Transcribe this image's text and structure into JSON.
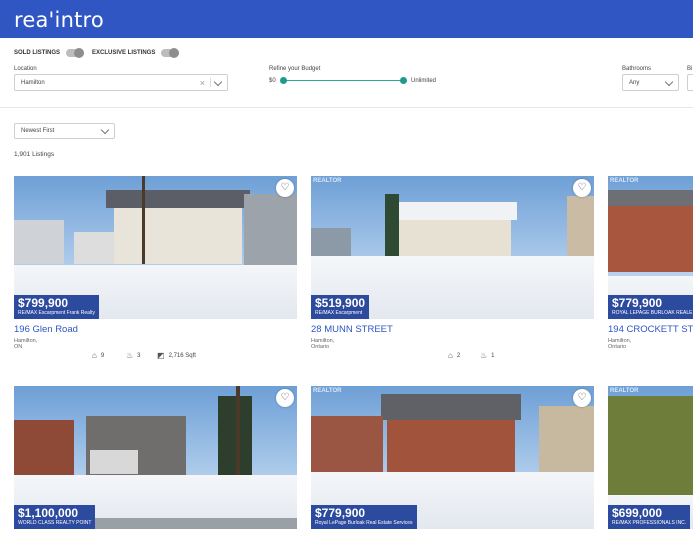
{
  "app": {
    "logo": "rea'intro"
  },
  "filters": {
    "sold_listings": "SOLD LISTINGS",
    "exclusive_listings": "EXCLUSIVE LISTINGS",
    "location_label": "Location",
    "location_value": "Hamilton",
    "budget_label": "Refine your Budget",
    "budget_min": "$0",
    "budget_max": "Unlimited",
    "bathrooms_label": "Bathrooms",
    "bathrooms_value": "Any",
    "next_label_partial": "Bi"
  },
  "sort": {
    "value": "Newest First"
  },
  "listing_count": "1,901 Listings",
  "listings": [
    {
      "price": "$799,900",
      "brokerage": "RE/MAX Escarpment Frank Realty",
      "address": "196 Glen Road",
      "city": "Hamilton, ON",
      "beds": "9",
      "baths": "3",
      "sqft": "2,716 Sqft"
    },
    {
      "price": "$519,900",
      "brokerage": "RE/MAX Escarpment",
      "address": "28 MUNN STREET",
      "city": "Hamilton, Ontario",
      "beds": "2",
      "baths": "1"
    },
    {
      "price": "$779,900",
      "brokerage": "ROYAL LEPAGE BURLOAK REALE",
      "address": "194 CROCKETT STR",
      "city": "Hamilton, Ontario"
    },
    {
      "price": "$1,100,000",
      "brokerage": "WORLD CLASS REALTY POINT"
    },
    {
      "price": "$779,900",
      "brokerage": "Royal LePage Burloak Real Estate Services"
    },
    {
      "price": "$699,000",
      "brokerage": "RE/MAX PROFESSIONALS INC."
    }
  ],
  "watermark": "REALTOR",
  "icons": {
    "heart": "heart-icon",
    "chevron": "chevron-down-icon",
    "clear": "close-icon",
    "bed": "bed-icon",
    "bath": "bath-icon",
    "area": "area-icon"
  },
  "colors": {
    "brand": "#2f56c3",
    "price_tag": "#2c4a9e",
    "slider": "#28a99b"
  }
}
